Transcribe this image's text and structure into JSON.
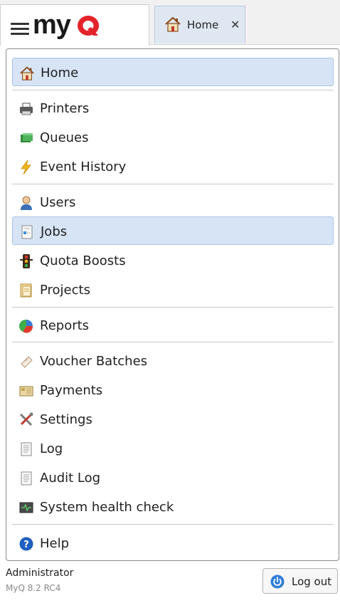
{
  "header": {
    "logo_text": "myq",
    "tab": {
      "label": "Home",
      "close": "✕",
      "icon": "home-icon"
    }
  },
  "menu": {
    "items": [
      {
        "label": "Home",
        "icon": "home-icon",
        "selected": true
      },
      {
        "label": "Printers",
        "icon": "printer-icon"
      },
      {
        "label": "Queues",
        "icon": "queue-icon"
      },
      {
        "label": "Event History",
        "icon": "lightning-icon"
      },
      {
        "label": "Users",
        "icon": "user-icon"
      },
      {
        "label": "Jobs",
        "icon": "document-icon",
        "selected": true
      },
      {
        "label": "Quota Boosts",
        "icon": "traffic-light-icon"
      },
      {
        "label": "Projects",
        "icon": "folder-icon"
      },
      {
        "label": "Reports",
        "icon": "pie-chart-icon"
      },
      {
        "label": "Voucher Batches",
        "icon": "voucher-icon"
      },
      {
        "label": "Payments",
        "icon": "payment-icon"
      },
      {
        "label": "Settings",
        "icon": "tools-icon"
      },
      {
        "label": "Log",
        "icon": "log-icon"
      },
      {
        "label": "Audit Log",
        "icon": "audit-log-icon"
      },
      {
        "label": "System health check",
        "icon": "health-monitor-icon"
      },
      {
        "label": "Help",
        "icon": "help-icon"
      }
    ]
  },
  "footer": {
    "user": "Administrator",
    "version": "MyQ 8.2 RC4",
    "logout_label": "Log out"
  },
  "colors": {
    "brand_red": "#e3242b",
    "selection": "#d6e4f6",
    "help_blue": "#1f5fbf"
  }
}
